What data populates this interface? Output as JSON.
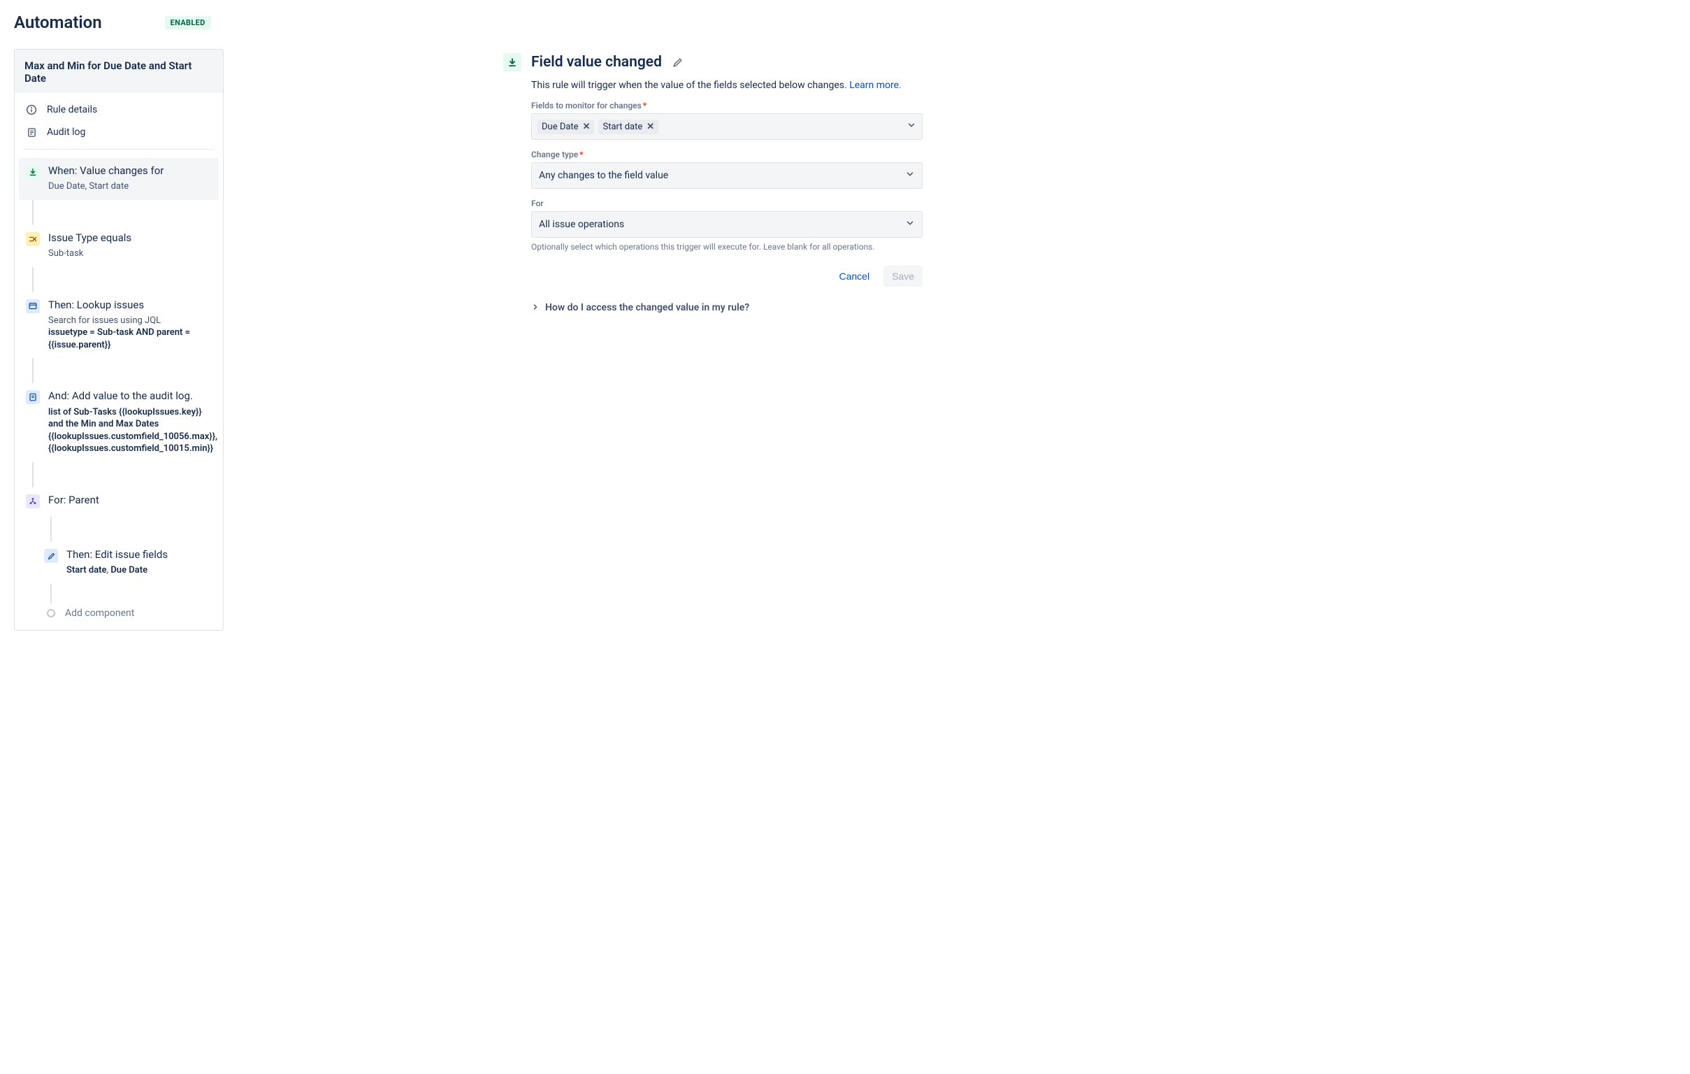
{
  "header": {
    "title": "Automation",
    "status": "ENABLED"
  },
  "rule": {
    "name": "Max and Min for Due Date and Start Date",
    "meta": {
      "details": "Rule details",
      "audit": "Audit log"
    },
    "steps": {
      "trigger": {
        "title": "When: Value changes for",
        "sub": "Due Date, Start date"
      },
      "cond": {
        "title": "Issue Type equals",
        "sub": "Sub-task"
      },
      "lookup": {
        "title": "Then: Lookup issues",
        "sub_plain": "Search for issues using JQL",
        "sub_bold": "issuetype = Sub-task AND parent = {{issue.parent}}"
      },
      "audit": {
        "title": "And: Add value to the audit log.",
        "sub_bold": "list of Sub-Tasks {{lookupIssues.key}} and the Min and Max Dates {{lookupIssues.customfield_10056.max}}, {{lookupIssues.customfield_10015.min}}"
      },
      "parent": {
        "title": "For: Parent"
      },
      "edit": {
        "title": "Then: Edit issue fields",
        "f1": "Start date",
        "sep": ", ",
        "f2": "Due Date"
      },
      "add": "Add component"
    }
  },
  "detail": {
    "title": "Field value changed",
    "desc": "This rule will trigger when the value of the fields selected below changes. ",
    "learn": "Learn more.",
    "fields_label": "Fields to monitor for changes",
    "chips": [
      "Due Date",
      "Start date"
    ],
    "change_label": "Change type",
    "change_value": "Any changes to the field value",
    "for_label": "For",
    "for_value": "All issue operations",
    "for_help": "Optionally select which operations this trigger will execute for. Leave blank for all operations.",
    "cancel": "Cancel",
    "save": "Save",
    "accordion": "How do I access the changed value in my rule?"
  }
}
